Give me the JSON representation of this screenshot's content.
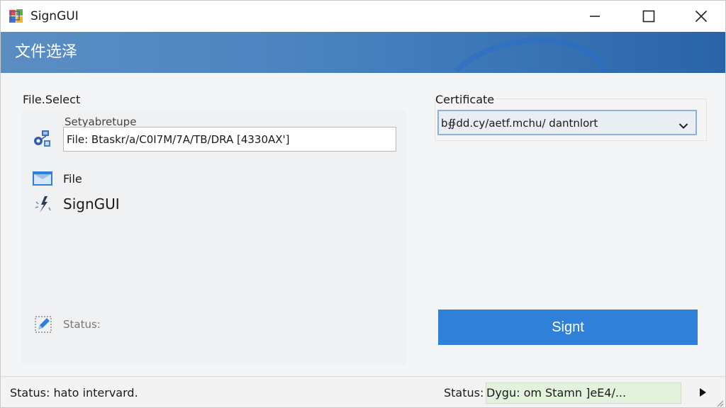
{
  "window": {
    "title": "SignGUI",
    "controls": [
      "minimize",
      "maximize",
      "close"
    ]
  },
  "banner": {
    "title": "文件选泽"
  },
  "file_select": {
    "section_label": "File.Select",
    "field_label": "Setyabretupe",
    "field_value": "File: Btaskr/a/C0I7M/7A/TB/DRA [4330AX']",
    "rows": [
      {
        "label": "File",
        "icon": "folder-icon"
      },
      {
        "label": "SignGUI",
        "icon": "signgui-icon"
      }
    ],
    "status_label": "Status:"
  },
  "certificate": {
    "section_label": "Certificate",
    "selected_value": "b∯dd.cy/aetf.mchu/ dantnlort"
  },
  "actions": {
    "sign_label": "Signt"
  },
  "statusbar": {
    "left_text": "Status: hato intervard.",
    "right_label": "Status: ",
    "right_value": "Dygu: om Stamn ]eE4/..."
  },
  "colors": {
    "accent": "#2f80d8",
    "banner": "#4f86c1",
    "status_ok": "#e3f2dc"
  }
}
